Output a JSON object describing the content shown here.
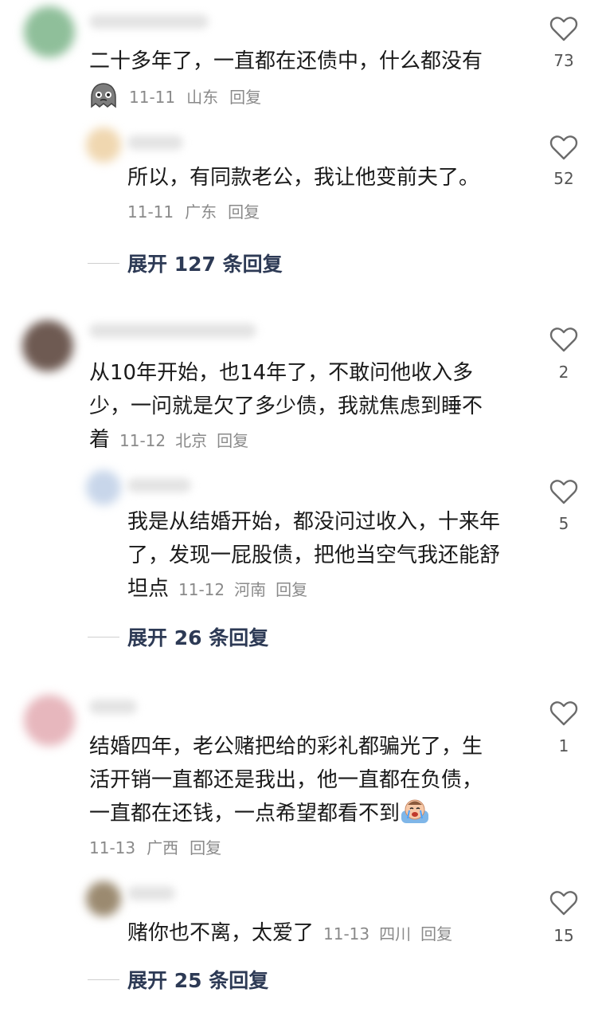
{
  "comments": [
    {
      "text_lines": [
        "二十多年了，一直都在还债中，什么都没有"
      ],
      "date": "11-11",
      "location": "山东",
      "reply_label": "回复",
      "likes": "73",
      "badge_icon": "grey-ghost-sticker-icon",
      "replies": [
        {
          "text_lines": [
            "所以，有同款老公，我让他变前夫了。"
          ],
          "date": "11-11",
          "location": "广东",
          "reply_label": "回复",
          "likes": "52"
        }
      ],
      "expand_label": "展开 127 条回复"
    },
    {
      "text_lines": [
        "从10年开始，也14年了，不敢问他收入多",
        "少，一问就是欠了多少债，我就焦虑到睡不",
        "着"
      ],
      "date": "11-12",
      "location": "北京",
      "reply_label": "回复",
      "likes": "2",
      "replies": [
        {
          "text_lines": [
            "我是从结婚开始，都没问过收入，十来年",
            "了，发现一屁股债，把他当空气我还能舒",
            "坦点"
          ],
          "date": "11-12",
          "location": "河南",
          "reply_label": "回复",
          "likes": "5"
        }
      ],
      "expand_label": "展开 26 条回复"
    },
    {
      "text_lines": [
        "结婚四年，老公赌把给的彩礼都骗光了，生",
        "活开销一直都还是我出，他一直都在负债，",
        "一直都在还钱，一点希望都看不到"
      ],
      "emoji": "crying-face-emoji-icon",
      "date": "11-13",
      "location": "广西",
      "reply_label": "回复",
      "likes": "1",
      "replies": [
        {
          "text_lines": [
            "赌你也不离，太爱了"
          ],
          "date": "11-13",
          "location": "四川",
          "reply_label": "回复",
          "likes": "15"
        }
      ],
      "expand_label": "展开 25 条回复"
    }
  ],
  "colors": {
    "text": "#1a1a1a",
    "meta": "#8a8a8a",
    "expand": "#2d3a55",
    "heart_stroke": "#6b6b6b"
  }
}
